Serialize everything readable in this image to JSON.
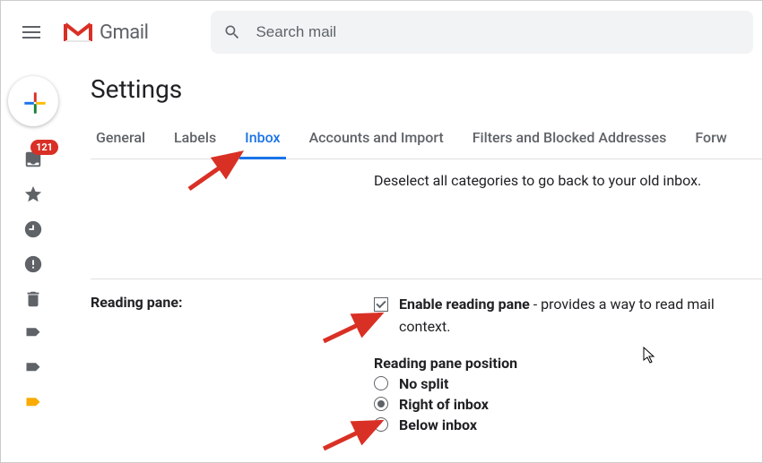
{
  "header": {
    "app_name": "Gmail",
    "search_placeholder": "Search mail"
  },
  "sidebar": {
    "badge": "121"
  },
  "settings": {
    "title": "Settings",
    "tabs": {
      "general": "General",
      "labels": "Labels",
      "inbox": "Inbox",
      "accounts": "Accounts and Import",
      "filters": "Filters and Blocked Addresses",
      "forwarding": "Forw"
    },
    "active_tab": "inbox",
    "deselect_note": "Deselect all categories to go back to your old inbox.",
    "reading_pane": {
      "label": "Reading pane:",
      "enable_bold": "Enable reading pane",
      "enable_desc": " - provides a way to read mail context.",
      "position_title": "Reading pane position",
      "options": {
        "no_split": "No split",
        "right": "Right of inbox",
        "below": "Below inbox"
      },
      "checked": true,
      "selected": "right"
    }
  }
}
